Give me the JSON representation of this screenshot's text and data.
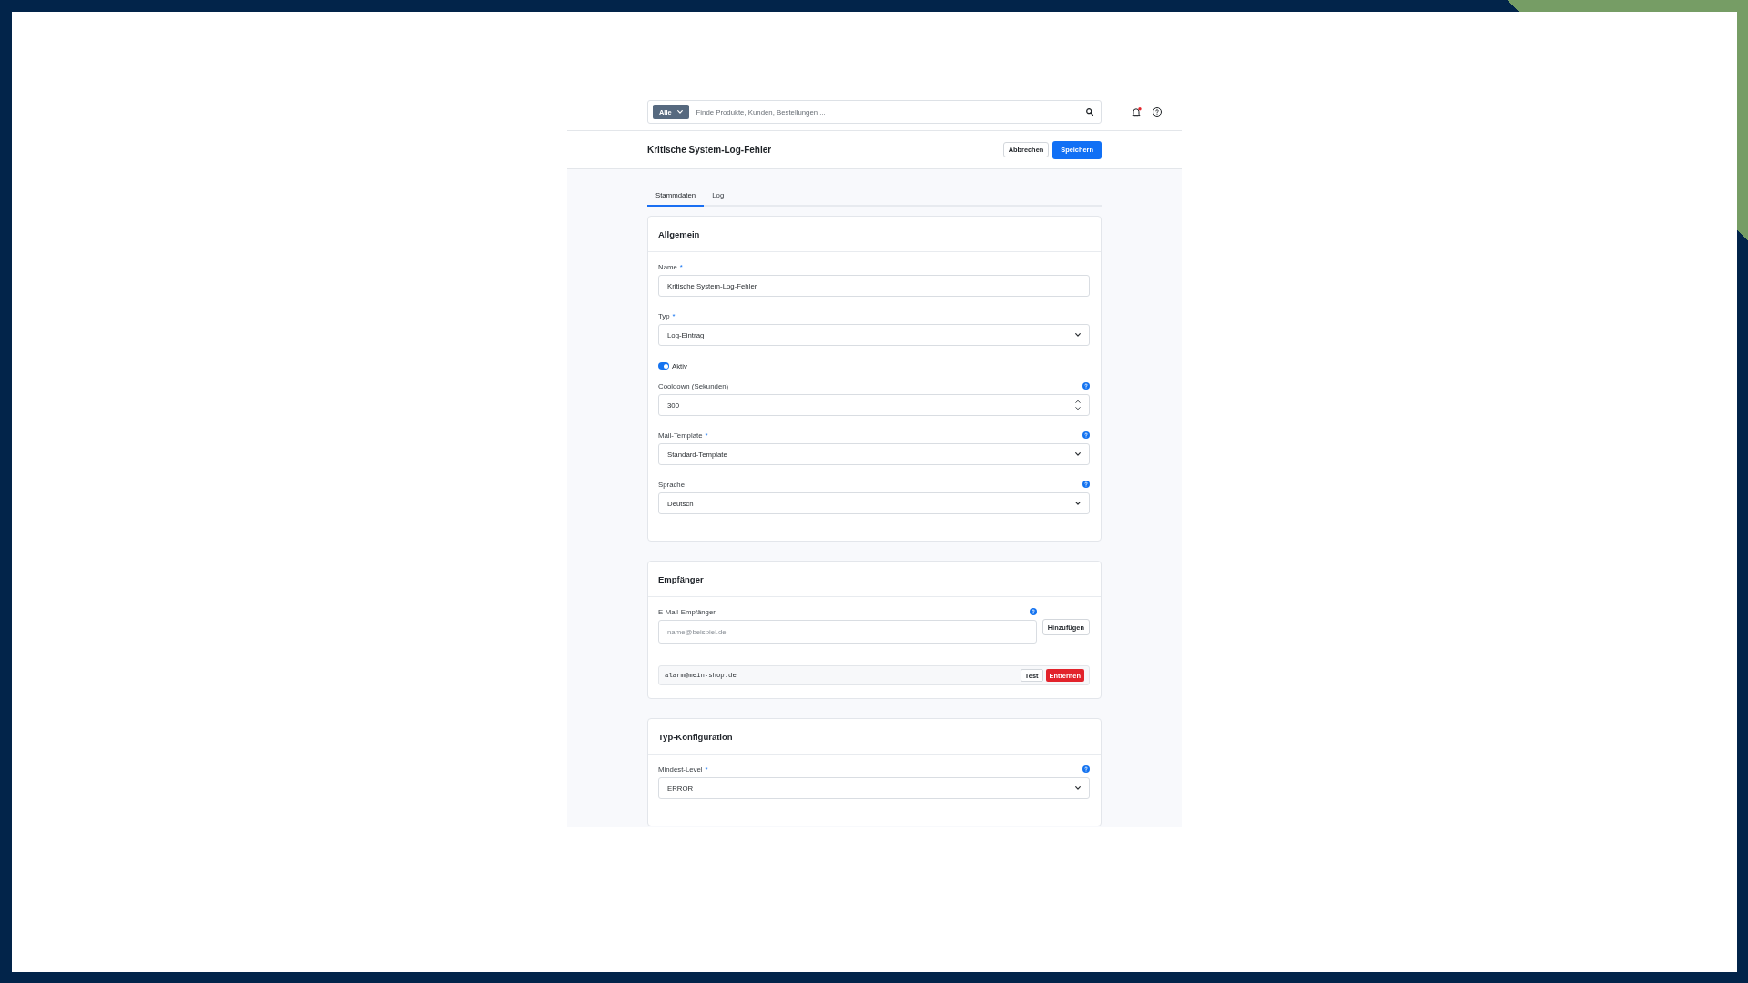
{
  "top_bar": {
    "search": {
      "scope": "Alle",
      "placeholder": "Finde Produkte, Kunden, Bestellungen ..."
    },
    "notifications": {
      "unread": true
    }
  },
  "page_header": {
    "title": "Kritische System-Log-Fehler",
    "buttons": [
      {
        "label": "Abbrechen",
        "kind": "secondary"
      },
      {
        "label": "Speichern",
        "kind": "primary"
      }
    ]
  },
  "tabs": [
    {
      "label": "Stammdaten",
      "selected": true
    },
    {
      "label": "Log",
      "selected": false
    }
  ],
  "sections": [
    {
      "title": "Allgemein",
      "fields": [
        {
          "kind": "text",
          "label": "Name",
          "required_mark": "*",
          "help_icon": false,
          "value": "Kritische System-Log-Fehler"
        },
        {
          "kind": "select",
          "label": "Typ",
          "required_mark": "*",
          "help_icon": false,
          "value": "Log-Eintrag"
        },
        {
          "kind": "toggle",
          "label": "Aktiv",
          "on": true
        },
        {
          "kind": "number",
          "label": "Cooldown (Sekunden)",
          "help_icon": true,
          "value": "300"
        },
        {
          "kind": "select",
          "label": "Mail-Template",
          "required_mark": "*",
          "help_icon": true,
          "value": "Standard-Template"
        },
        {
          "kind": "select",
          "label": "Sprache",
          "help_icon": true,
          "value": "Deutsch"
        }
      ]
    },
    {
      "title": "Empfänger",
      "fields": [
        {
          "kind": "email_add",
          "label": "E-Mail-Empfänger",
          "help_icon": true,
          "placeholder": "name@beispiel.de",
          "button": "Hinzufügen"
        },
        {
          "kind": "recipients",
          "items": [
            {
              "address": "alarm@mein-shop.de",
              "test_button": "Test",
              "remove_button": "Entfernen"
            }
          ]
        }
      ]
    },
    {
      "title": "Typ-Konfiguration",
      "fields": [
        {
          "kind": "select",
          "label": "Mindest-Level",
          "required_mark": "*",
          "help_icon": true,
          "value": "ERROR"
        }
      ]
    }
  ]
}
